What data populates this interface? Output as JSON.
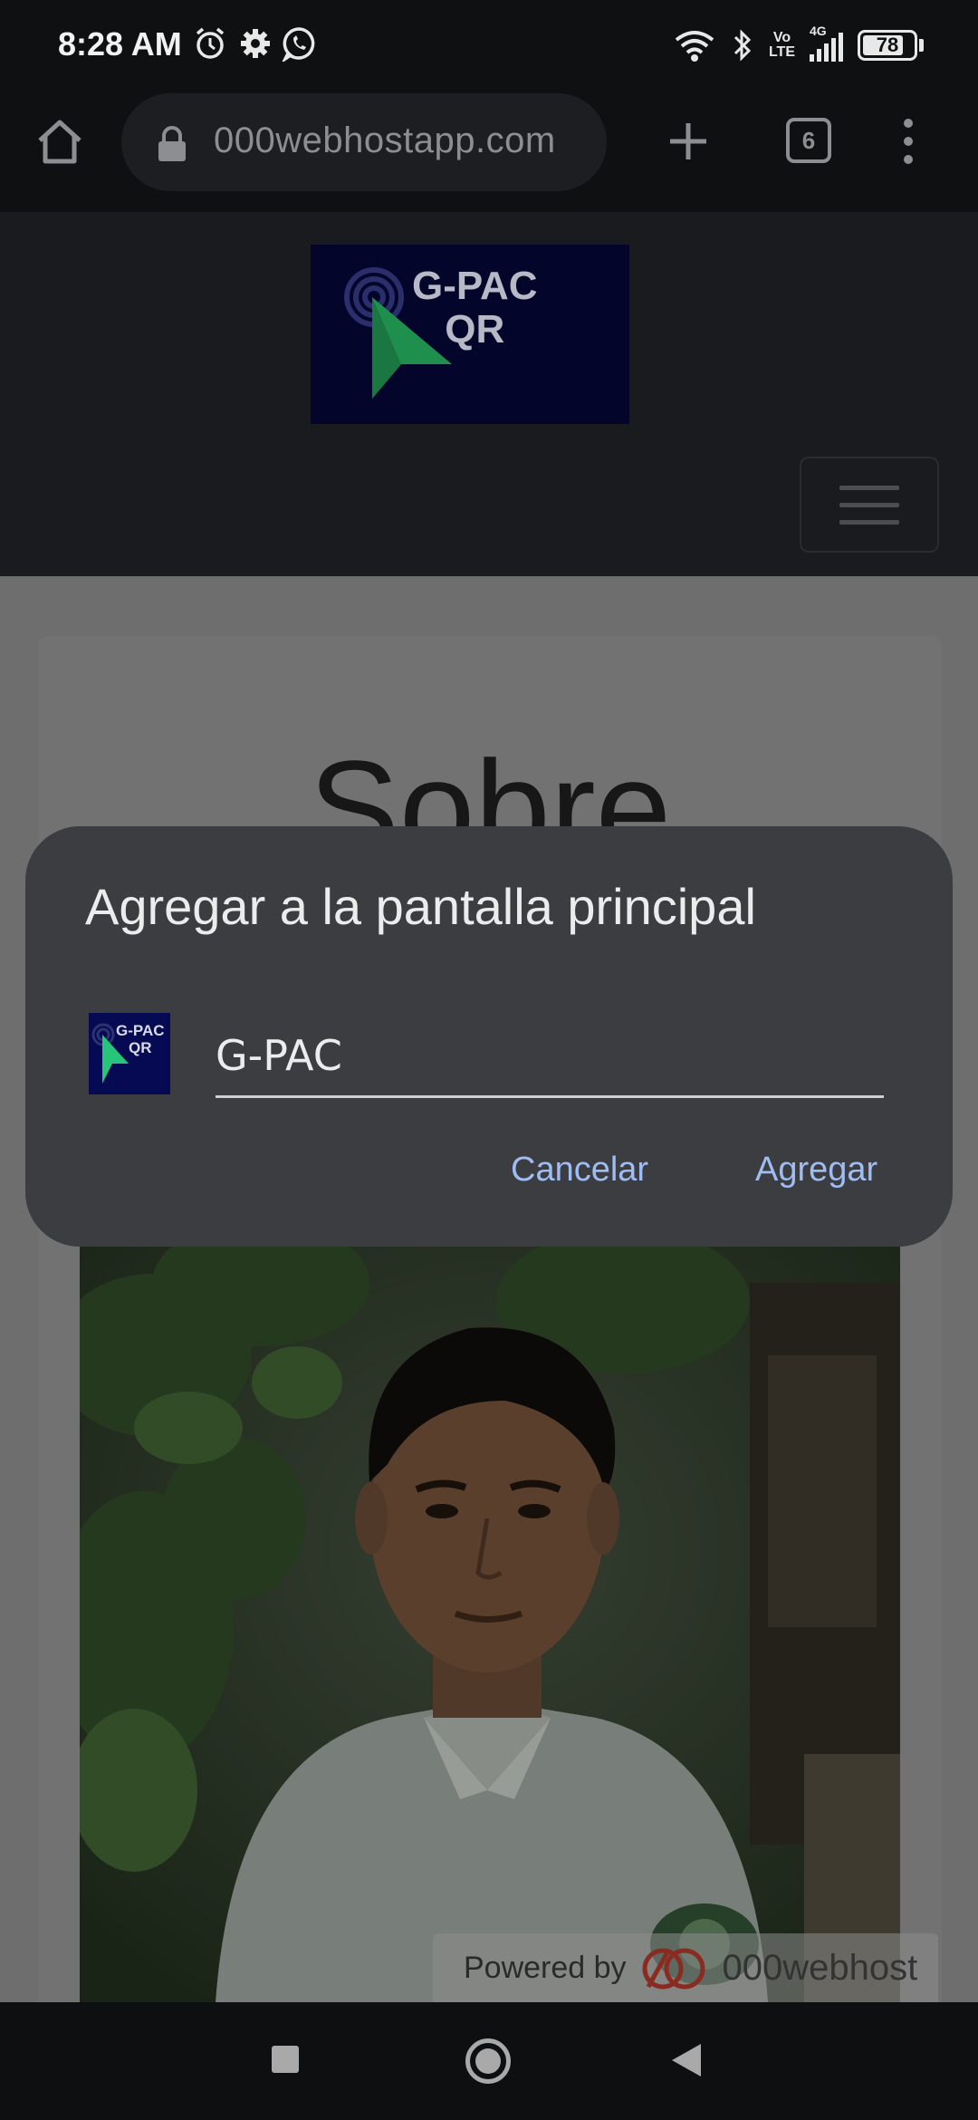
{
  "status_bar": {
    "time": "8:28 AM",
    "battery": "78",
    "network": "4G",
    "volte": "Vo\nLTE",
    "icons": [
      "alarm-icon",
      "gear-icon",
      "whatsapp-icon",
      "wifi-icon",
      "bluetooth-icon",
      "volte-icon",
      "signal-icon",
      "battery-icon"
    ]
  },
  "browser": {
    "url": "000webhostapp.com",
    "tab_count": "6",
    "icons": [
      "home-icon",
      "lock-icon",
      "plus-icon",
      "tab-switcher-icon",
      "more-vert-icon"
    ]
  },
  "site": {
    "logo_line1": "G-PAC",
    "logo_line2": "QR",
    "heading": "Sobre",
    "powered_by": "Powered by",
    "powered_brand": "000webhost"
  },
  "dialog": {
    "title": "Agregar a la pantalla principal",
    "icon_line1": "G-PAC",
    "icon_line2": "QR",
    "name_value": "G-PAC",
    "cancel_label": "Cancelar",
    "add_label": "Agregar"
  },
  "colors": {
    "accent": "#9fbcf3",
    "dialog_bg": "#3c3d40",
    "logo_bg": "#03062a"
  }
}
